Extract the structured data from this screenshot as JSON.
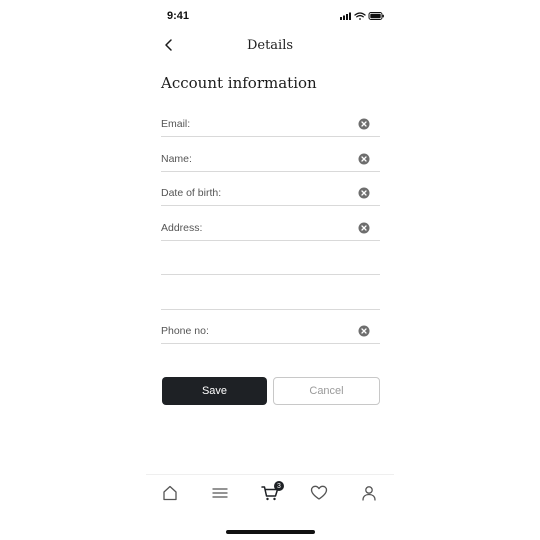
{
  "status_bar": {
    "time": "9:41"
  },
  "header": {
    "title": "Details"
  },
  "section": {
    "title": "Account information"
  },
  "fields": {
    "email": {
      "label": "Email:"
    },
    "name": {
      "label": "Name:"
    },
    "dob": {
      "label": "Date of birth:"
    },
    "address": {
      "label": "Address:"
    },
    "phone": {
      "label": "Phone no:"
    }
  },
  "buttons": {
    "save_label": "Save",
    "cancel_label": "Cancel"
  },
  "tabbar": {
    "cart_count": "3",
    "active_tab": "cart"
  },
  "colors": {
    "primary": "#1e2125",
    "divider": "#d9d9d9",
    "muted_text": "#9a9a9a"
  }
}
